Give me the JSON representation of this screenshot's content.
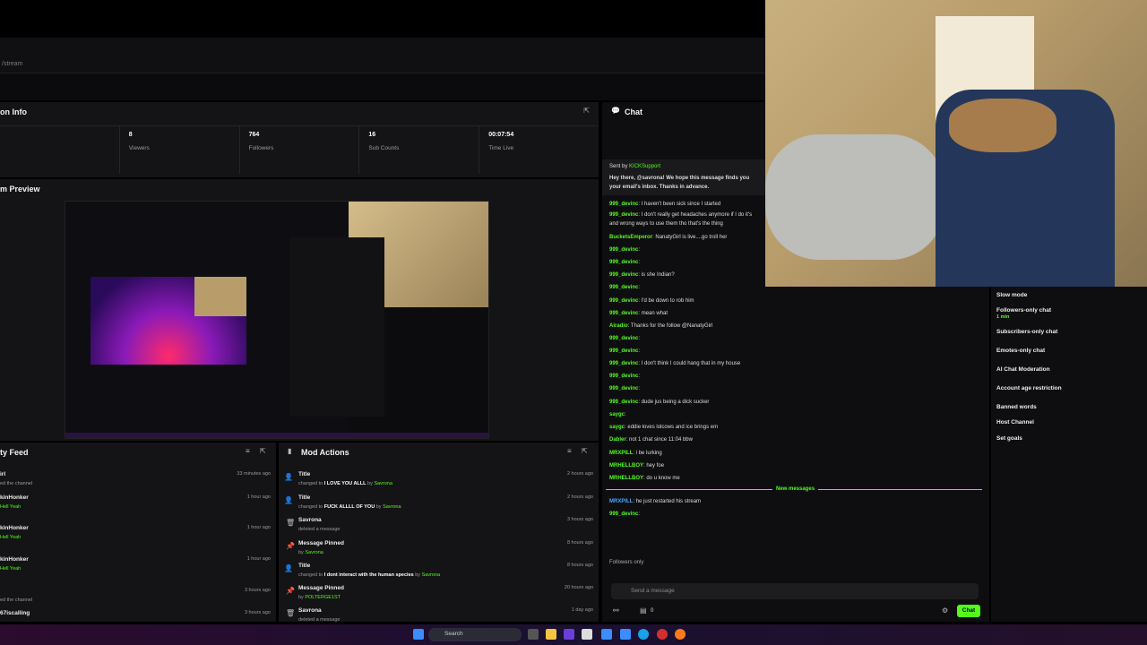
{
  "url": "/stream",
  "stream_info": {
    "title": "on Info",
    "stats": [
      {
        "value": "",
        "label": ""
      },
      {
        "value": "8",
        "label": "Viewers"
      },
      {
        "value": "764",
        "label": "Followers"
      },
      {
        "value": "16",
        "label": "Sub Counts"
      },
      {
        "value": "00:07:54",
        "label": "Time Live"
      }
    ]
  },
  "preview": {
    "title": "m Preview"
  },
  "feed": {
    "title": "ty Feed",
    "items": [
      {
        "name": "irl",
        "sub": "ed the channel",
        "time": "33 minutes ago"
      },
      {
        "name": "kinHonker",
        "sub": "Hell Yeah",
        "time": "1 hour ago"
      },
      {
        "name": "kinHonker",
        "sub": "Hell Yeah",
        "time": "1 hour ago"
      },
      {
        "name": "kinHonker",
        "sub": "Hell Yeah",
        "time": "1 hour ago"
      },
      {
        "name": "",
        "sub": "ed the channel",
        "time": "3 hours ago"
      },
      {
        "name": "67iscalling",
        "sub": "",
        "time": "3 hours ago"
      }
    ]
  },
  "mod_actions": {
    "title": "Mod Actions",
    "items": [
      {
        "title": "Title",
        "pre": "changed to ",
        "val": "I LOVE YOU ALLL",
        "mid": " by ",
        "by": "Savrona",
        "time": "2 hours ago"
      },
      {
        "title": "Title",
        "pre": "changed to ",
        "val": "FUCK ALLLL OF YOU",
        "mid": " by ",
        "by": "Savrona",
        "time": "2 hours ago"
      },
      {
        "title": "Savrona",
        "pre": "deleted a message",
        "val": "",
        "mid": "",
        "by": "",
        "time": "3 hours ago"
      },
      {
        "title": "Message Pinned",
        "pre": "by ",
        "val": "",
        "mid": "",
        "by": "Savrona",
        "time": "8 hours ago"
      },
      {
        "title": "Title",
        "pre": "changed to ",
        "val": "I dont interact with the human species",
        "mid": " by ",
        "by": "Savrona",
        "time": "8 hours ago"
      },
      {
        "title": "Message Pinned",
        "pre": "by ",
        "val": "",
        "mid": "",
        "by": "POLTERGE1ST",
        "time": "20 hours ago"
      },
      {
        "title": "Savrona",
        "pre": "deleted a message",
        "val": "",
        "mid": "",
        "by": "",
        "time": "1 day ago"
      }
    ]
  },
  "chat": {
    "title": "Chat",
    "pinned_by": "Sent by",
    "pinned_user": "KICKSupport",
    "pinned_text_1": "Hey there, @savrona! We hope this message finds you",
    "pinned_text_2": "your email's inbox. Thanks in advance.",
    "messages": [
      {
        "user": "999_devinc",
        "text": "I haven't been sick since I started"
      },
      {
        "user": "999_devinc",
        "text": "I don't really get headaches anymore if I do it's"
      },
      {
        "user": "",
        "text": "and wrong ways to use them tho that's the thing"
      },
      {
        "user": "BucketsEmperor",
        "text": "NanatyGirl is live....go troll her"
      },
      {
        "user": "999_devinc",
        "text": ""
      },
      {
        "user": "999_devinc",
        "text": ""
      },
      {
        "user": "999_devinc",
        "text": "is she Indian?"
      },
      {
        "user": "999_devinc",
        "text": ""
      },
      {
        "user": "999_devinc",
        "text": "I'd be down to rob him"
      },
      {
        "user": "999_devinc",
        "text": "mean what"
      },
      {
        "user": "Airadio",
        "text": "Thanks for the follow @NanatyGirl"
      },
      {
        "user": "999_devinc",
        "text": ""
      },
      {
        "user": "999_devinc",
        "text": ""
      },
      {
        "user": "999_devinc",
        "text": "I don't think I could hang that in my house"
      },
      {
        "user": "999_devinc",
        "text": ""
      },
      {
        "user": "999_devinc",
        "text": ""
      },
      {
        "user": "999_devinc",
        "text": "dude jus being a dick sucker"
      },
      {
        "user": "saygc",
        "text": ""
      },
      {
        "user": "saygc",
        "text": "eddie loves lolcows and ice brings em"
      },
      {
        "user": "Dabler",
        "text": "not 1 chat since 11:04 bbw"
      },
      {
        "user": "MRXPILL",
        "text": "i be lurking"
      },
      {
        "user": "MRHELLBOY",
        "text": "hey foe"
      },
      {
        "user": "MRHELLBOY",
        "text": "do u know me"
      }
    ],
    "new_messages": "New messages",
    "after": [
      {
        "user": "MRXPILL",
        "text": "he just restarted his stream"
      },
      {
        "user": "999_devinc",
        "text": ""
      }
    ],
    "followers_only": "Followers only",
    "placeholder": "Send a message",
    "count": "0",
    "send": "Chat"
  },
  "mod_settings": [
    "Slow mode",
    "Followers-only chat",
    "1 min",
    "Subscribers-only chat",
    "Emotes-only chat",
    "AI Chat Moderation",
    "Account age restriction",
    "Banned words",
    "Host Channel",
    "Set goals"
  ],
  "taskbar": {
    "search": "Search"
  },
  "colors": {
    "accent": "#53fc18",
    "panel": "#141416",
    "bg": "#000000"
  }
}
